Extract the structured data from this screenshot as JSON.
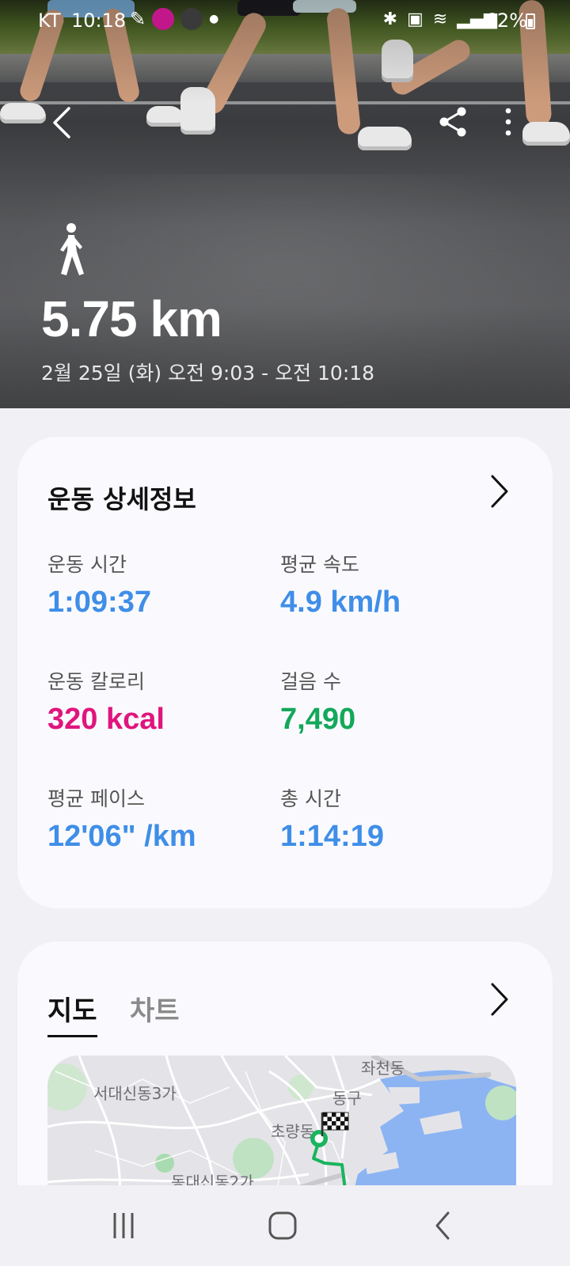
{
  "status_bar": {
    "carrier": "KT",
    "time": "10:18",
    "battery": "62%"
  },
  "hero": {
    "distance": "5.75 km",
    "date_range": "2월 25일 (화) 오전 9:03 - 오전 10:18"
  },
  "details": {
    "title": "운동 상세정보",
    "stats": [
      {
        "label": "운동 시간",
        "value": "1:09:37"
      },
      {
        "label": "평균 속도",
        "value": "4.9 km/h"
      },
      {
        "label": "운동 칼로리",
        "value": "320 kcal"
      },
      {
        "label": "걸음 수",
        "value": "7,490"
      },
      {
        "label": "평균 페이스",
        "value": "12'06\" /km"
      },
      {
        "label": "총 시간",
        "value": "1:14:19"
      }
    ]
  },
  "map_section": {
    "tabs": [
      "지도",
      "차트"
    ],
    "places": [
      "좌천동",
      "서대신동3가",
      "동구",
      "초량동",
      "동대신동2가"
    ]
  },
  "colors": {
    "accent_blue": "#3f8ee8",
    "calorie_pink": "#e0157d",
    "steps_green": "#13a85a",
    "route_green": "#19b45e",
    "water_blue": "#8cb4f3"
  },
  "icons": {
    "back": "chevron-left-icon",
    "share": "share-icon",
    "more": "more-vertical-icon",
    "activity": "walking-person-icon",
    "finish": "checkered-flag-icon",
    "start": "start-marker-icon"
  }
}
